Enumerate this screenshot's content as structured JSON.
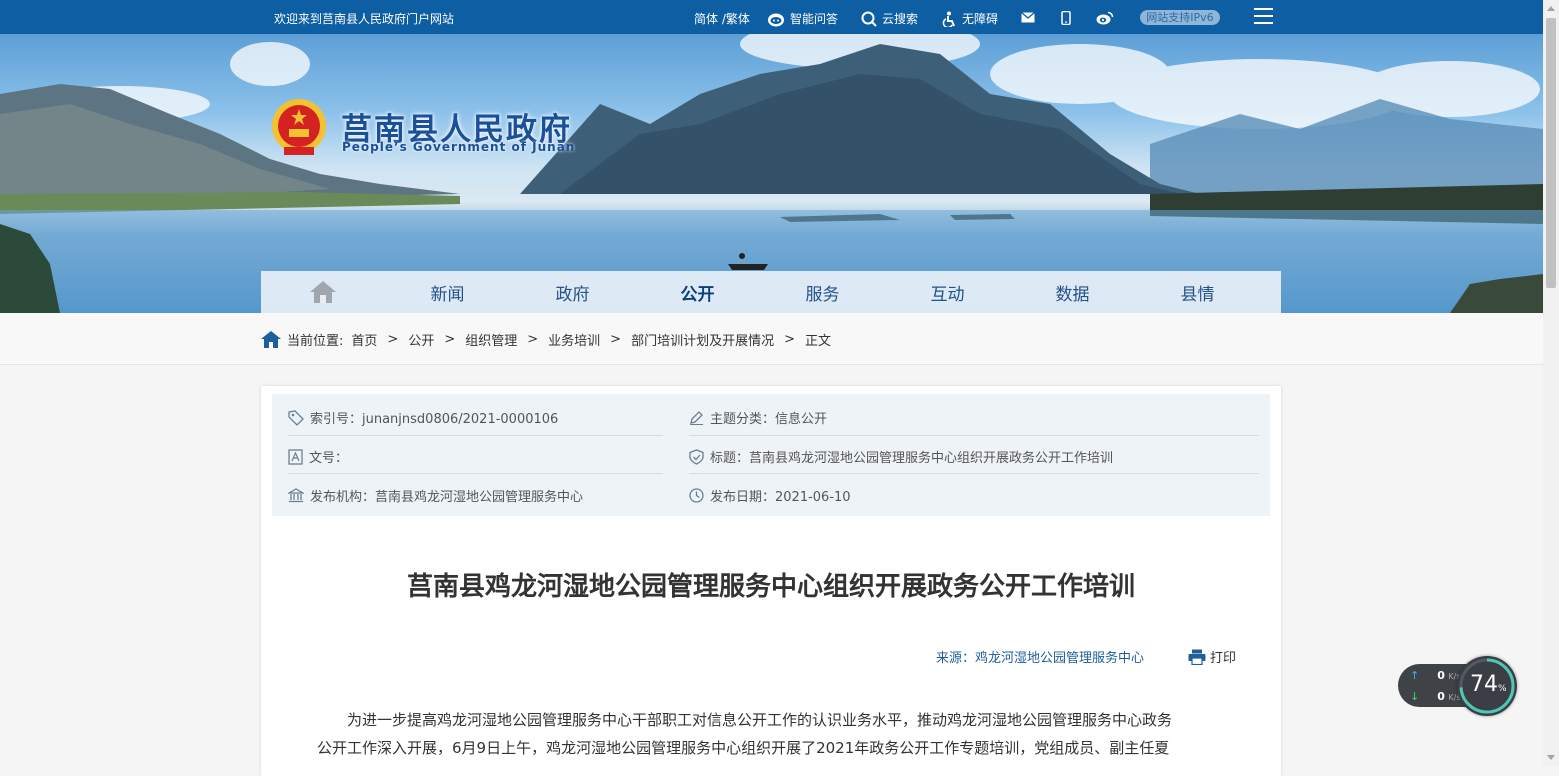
{
  "topbar": {
    "welcome": "欢迎来到莒南县人民政府门户网站",
    "lang": "简体 /繁体",
    "qa": "智能问答",
    "search": "云搜索",
    "accessibility": "无障碍",
    "ipv6": "网站支持IPv6"
  },
  "header": {
    "title": "莒南县人民政府",
    "subtitle": "People’s Government of Junan"
  },
  "nav": {
    "items": [
      "新闻",
      "政府",
      "公开",
      "服务",
      "互动",
      "数据",
      "县情"
    ],
    "active": "公开"
  },
  "breadcrumb": {
    "label": "当前位置:",
    "items": [
      "首页",
      "公开",
      "组织管理",
      "业务培训",
      "部门培训计划及开展情况",
      "正文"
    ],
    "separator": ">"
  },
  "meta": {
    "index": "索引号：junanjnsd0806/2021-0000106",
    "category": "主题分类：信息公开",
    "doc_no": "文号：",
    "title": "标题：莒南县鸡龙河湿地公园管理服务中心组织开展政务公开工作培训",
    "publisher": "发布机构：莒南县鸡龙河湿地公园管理服务中心",
    "date": "发布日期：2021-06-10"
  },
  "article": {
    "title": "莒南县鸡龙河湿地公园管理服务中心组织开展政务公开工作培训",
    "source": "来源：鸡龙河湿地公园管理服务中心",
    "print": "打印",
    "para_line1": "为进一步提高鸡龙河湿地公园管理服务中心干部职工对信息公开工作的认识业务水平，推动鸡龙河湿地公园管理服务中心政务",
    "para_line2": "公开工作深入开展，6月9日上午，鸡龙河湿地公园管理服务中心组织开展了2021年政务公开工作专题培训，党组成员、副主任夏"
  },
  "widget": {
    "up": "0",
    "down": "0",
    "unit": "K/s",
    "percent": "74",
    "percent_sign": "%"
  },
  "colors": {
    "topbar": "#0d5ea3",
    "title_blue": "#1a4f99",
    "link_blue": "#1d5f9a"
  }
}
